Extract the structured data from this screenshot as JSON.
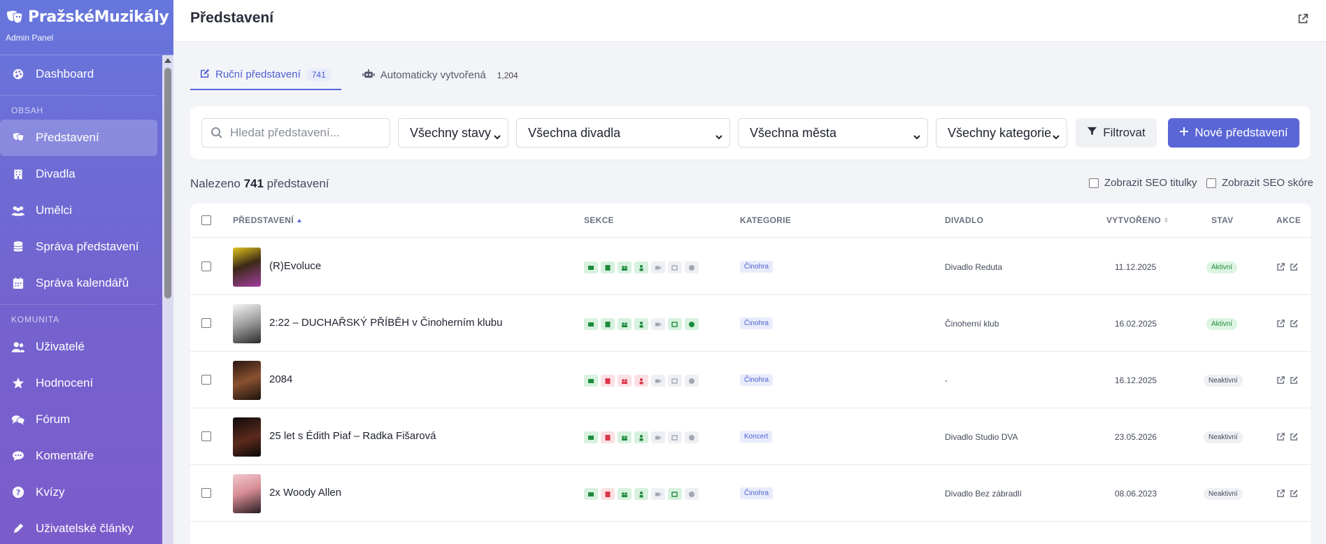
{
  "brand": {
    "name": "PražskéMuzikály",
    "subtitle": "Admin Panel"
  },
  "sidebar": {
    "items": [
      {
        "label": "Dashboard",
        "icon": "palette-icon"
      },
      {
        "label": "Představení",
        "icon": "masks-icon",
        "active": true
      },
      {
        "label": "Divadla",
        "icon": "building-icon"
      },
      {
        "label": "Umělci",
        "icon": "users-icon"
      },
      {
        "label": "Správa představení",
        "icon": "database-icon"
      },
      {
        "label": "Správa kalendářů",
        "icon": "calendar-icon"
      },
      {
        "label": "Uživatelé",
        "icon": "user-group-icon"
      },
      {
        "label": "Hodnocení",
        "icon": "star-icon"
      },
      {
        "label": "Fórum",
        "icon": "comments-icon"
      },
      {
        "label": "Komentáře",
        "icon": "comment-icon"
      },
      {
        "label": "Kvízy",
        "icon": "question-icon"
      },
      {
        "label": "Uživatelské články",
        "icon": "pen-icon"
      }
    ],
    "sections": {
      "content": "OBSAH",
      "community": "KOMUNITA"
    }
  },
  "header": {
    "title": "Představení"
  },
  "tabs": [
    {
      "label": "Ruční představení",
      "count": "741",
      "icon": "edit-icon",
      "active": true
    },
    {
      "label": "Automaticky vytvořená",
      "count": "1,204",
      "icon": "robot-icon"
    }
  ],
  "filters": {
    "search_placeholder": "Hledat představení...",
    "status": "Všechny stavy",
    "theater": "Všechna divadla",
    "city": "Všechna města",
    "category": "Všechny kategorie",
    "filter_button": "Filtrovat",
    "new_button": "Nové představení"
  },
  "summary": {
    "prefix": "Nalezeno",
    "count": "741",
    "suffix": "představení"
  },
  "options": {
    "seo_titles": "Zobrazit SEO titulky",
    "seo_score": "Zobrazit SEO skóre"
  },
  "table": {
    "headers": {
      "title": "PŘEDSTAVENÍ",
      "sections": "SEKCE",
      "category": "KATEGORIE",
      "theater": "DIVADLO",
      "created": "VYTVOŘENO",
      "status": "STAV",
      "actions": "AKCE"
    },
    "rows": [
      {
        "title": "(R)Evoluce",
        "category": "Činohra",
        "theater": "Divadlo Reduta",
        "created": "11.12.2025",
        "status": "Aktivní",
        "active": true,
        "sections": [
          "ok",
          "ok",
          "ok",
          "ok",
          "off",
          "off",
          "off"
        ]
      },
      {
        "title": "2:22 – DUCHAŘSKÝ PŘÍBĚH v Činoherním klubu",
        "category": "Činohra",
        "theater": "Činoherní klub",
        "created": "16.02.2025",
        "status": "Aktivní",
        "active": true,
        "sections": [
          "ok",
          "ok",
          "ok",
          "ok",
          "off",
          "ok",
          "ok"
        ]
      },
      {
        "title": "2084",
        "category": "Činohra",
        "theater": "-",
        "created": "16.12.2025",
        "status": "Neaktivní",
        "active": false,
        "sections": [
          "ok",
          "bad",
          "bad",
          "bad",
          "off",
          "off",
          "off"
        ]
      },
      {
        "title": "25 let s Édith Piaf – Radka Fišarová",
        "category": "Koncert",
        "theater": "Divadlo Studio DVA",
        "created": "23.05.2026",
        "status": "Neaktivní",
        "active": false,
        "sections": [
          "ok",
          "bad",
          "ok",
          "ok",
          "off",
          "off",
          "off"
        ]
      },
      {
        "title": "2x Woody Allen",
        "category": "Činohra",
        "theater": "Divadlo Bez zábradlí",
        "created": "08.06.2023",
        "status": "Neaktivní",
        "active": false,
        "sections": [
          "ok",
          "bad",
          "ok",
          "ok",
          "off",
          "ok",
          "off"
        ]
      }
    ]
  },
  "colors": {
    "accent": "#5a66d6",
    "sidebar_top": "#6676dc",
    "sidebar_bottom": "#7b5ccb",
    "ok": "#1e8a3e",
    "bad": "#d9364a"
  }
}
